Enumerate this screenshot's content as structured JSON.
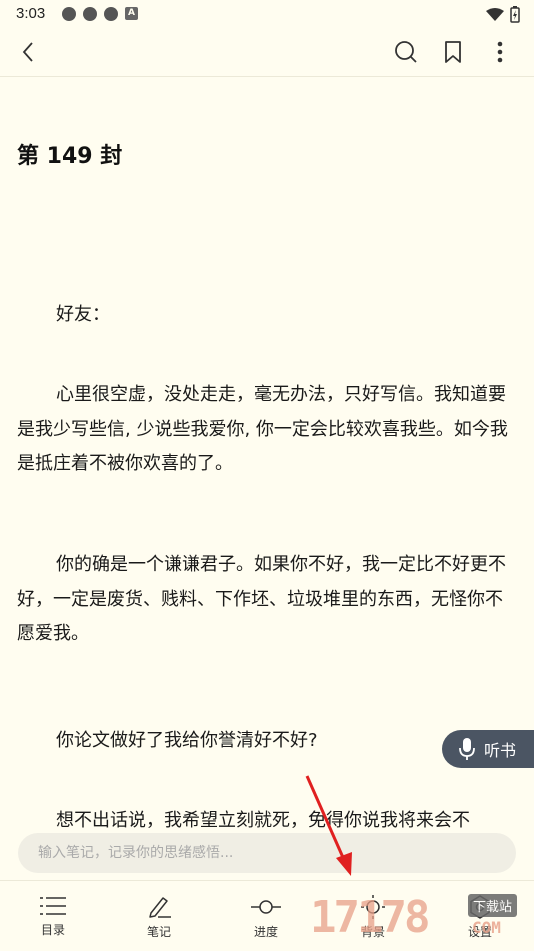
{
  "status_bar": {
    "time": "3:03"
  },
  "toolbar": {
    "back": "back-icon",
    "search": "search-icon",
    "bookmark": "bookmark-icon",
    "more": "more-icon"
  },
  "content": {
    "chapter_title": "第 149 封",
    "paragraphs": [
      "好友：",
      "心里很空虚，没处走走，毫无办法，只好写信。我知道要是我少写些信, 少说些我爱你, 你一定会比较欢喜我些。如今我是抵庄着不被你欢喜的了。",
      "你的确是一个谦谦君子。如果你不好，我一定比不好更不好，一定是废货、贱料、下作坯、垃圾堆里的东西，无怪你不愿爱我。",
      "你论文做好了我给你誉清好不好?",
      "想不出话说，我希望立刻就死，免得你说我将来会不"
    ]
  },
  "listen_button": {
    "label": "听书"
  },
  "note": {
    "placeholder": "输入笔记，记录你的思绪感悟..."
  },
  "bottom_nav": [
    {
      "label": "目录",
      "icon": "list-icon"
    },
    {
      "label": "笔记",
      "icon": "pencil-icon"
    },
    {
      "label": "进度",
      "icon": "progress-icon"
    },
    {
      "label": "背景",
      "icon": "brightness-icon"
    },
    {
      "label": "设置",
      "icon": "settings-icon"
    }
  ],
  "watermark": {
    "text": "17178",
    "badge": "下载站",
    "suffix": "COM"
  },
  "colors": {
    "background": "#fffdf0",
    "listen_bg": "#4b5563",
    "arrow": "#e02020"
  }
}
